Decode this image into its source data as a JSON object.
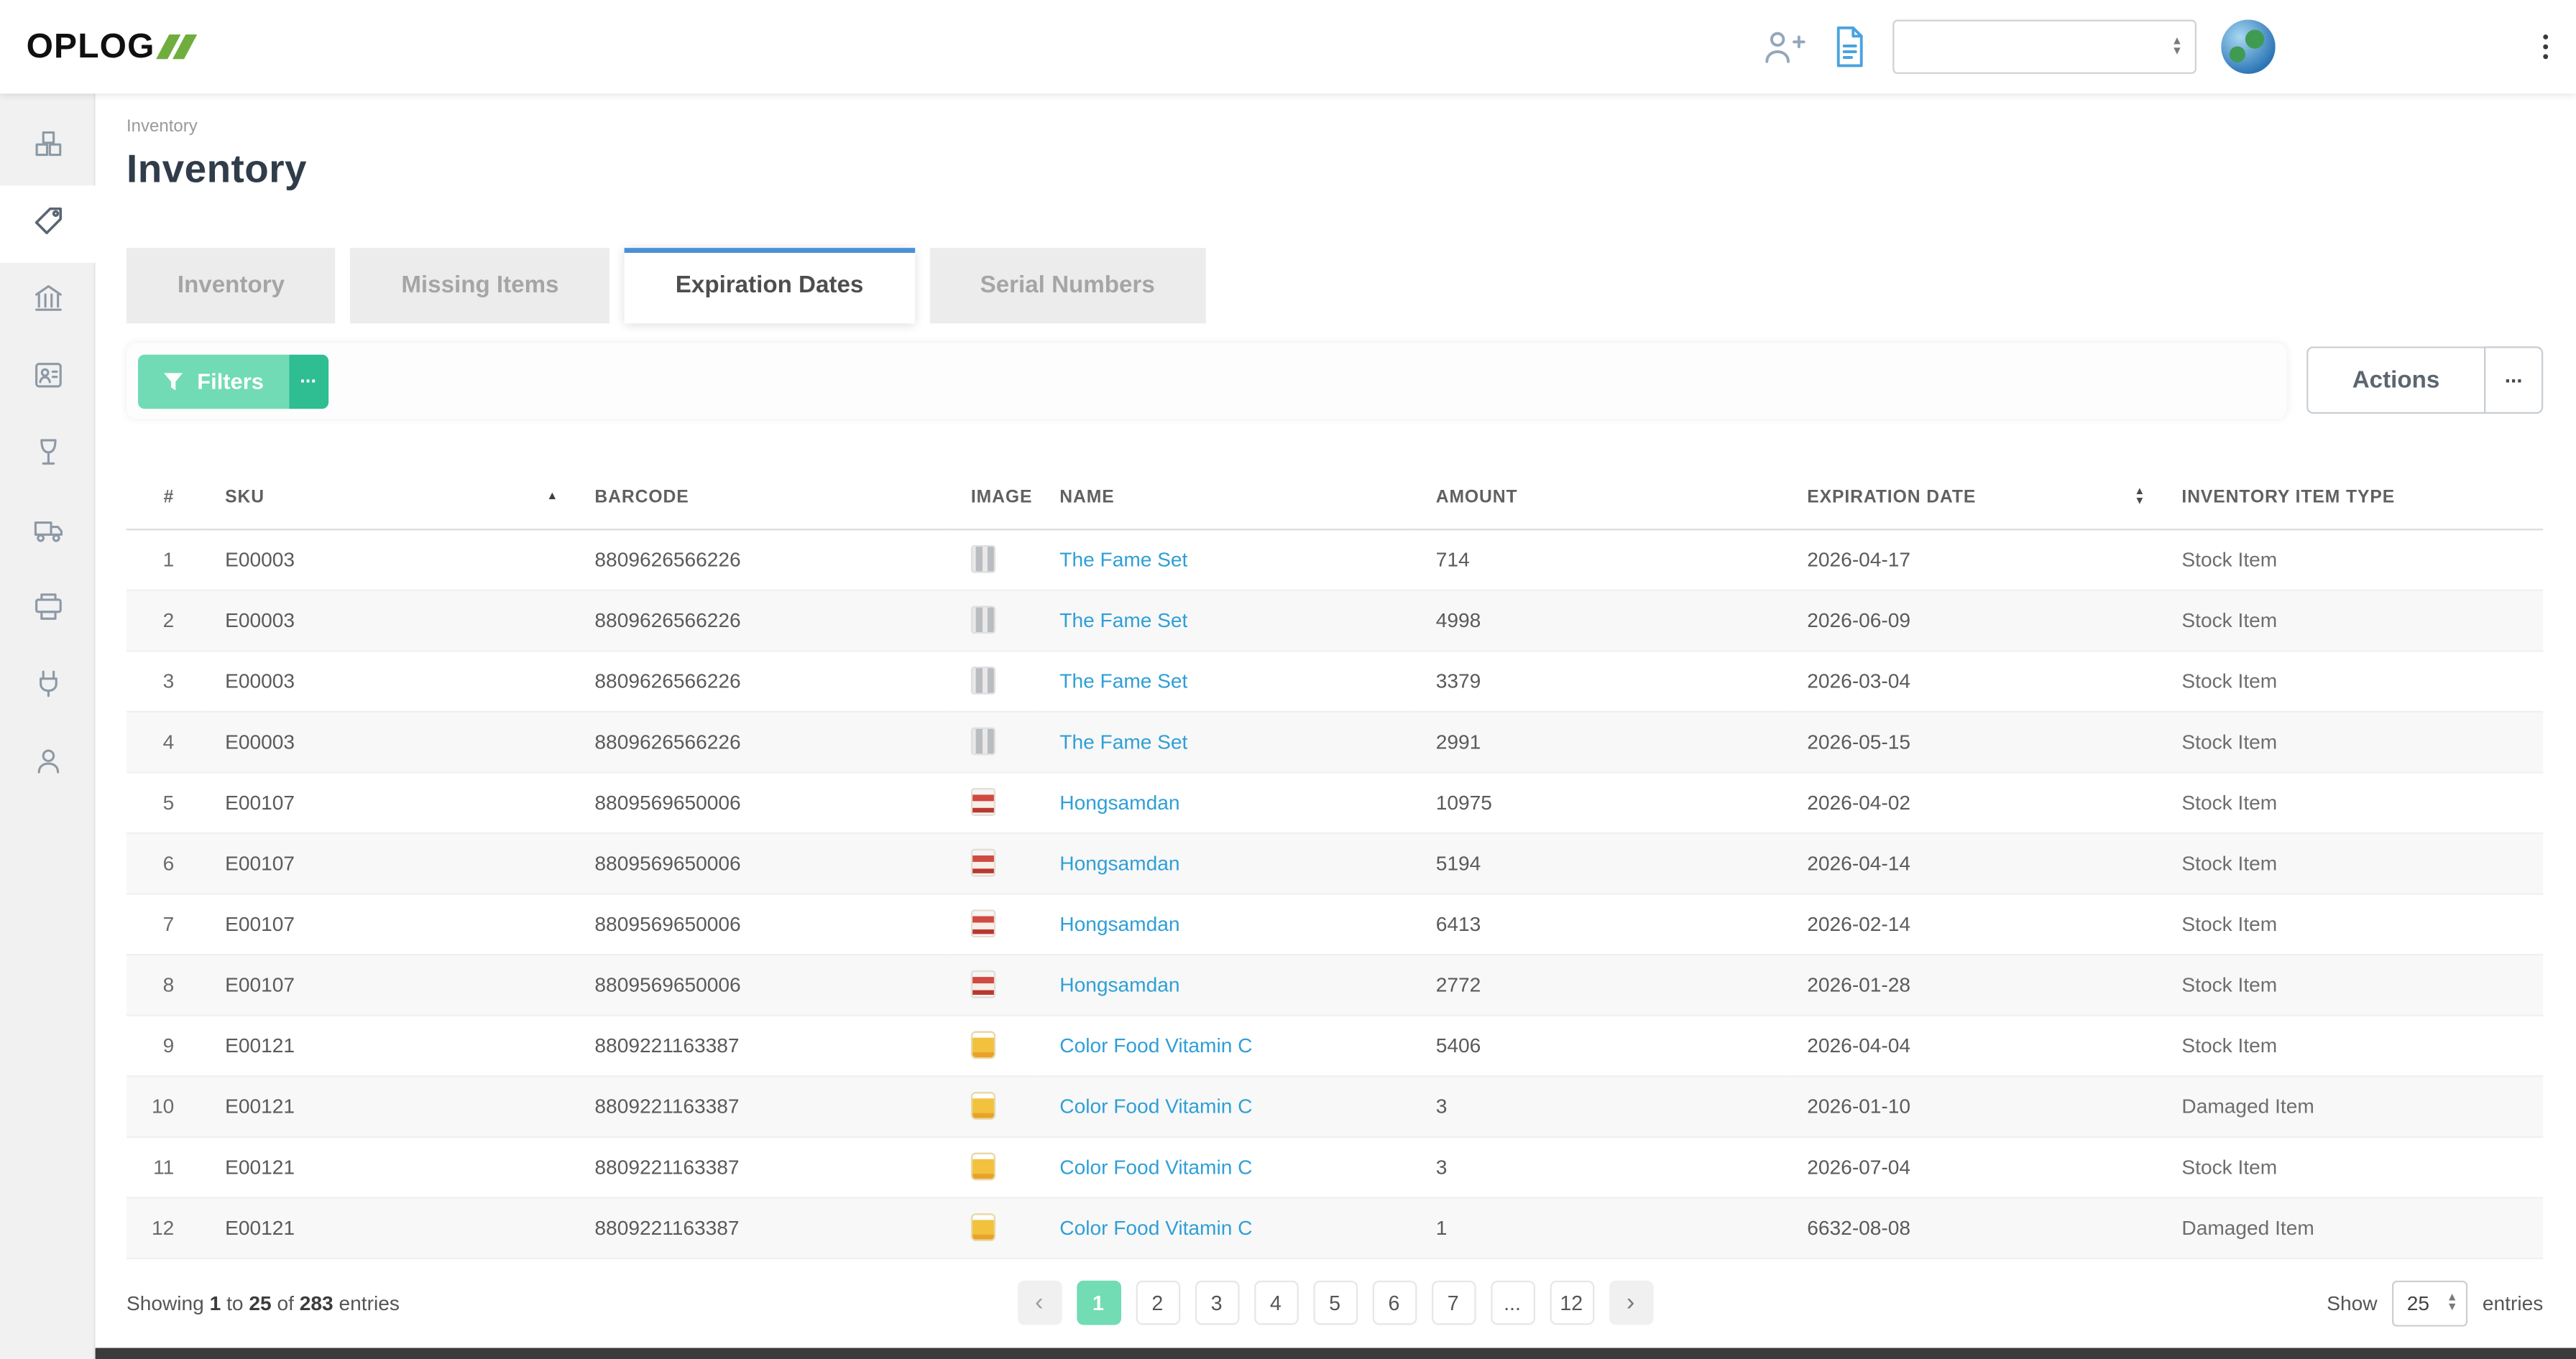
{
  "brand": {
    "name": "OPLOG"
  },
  "topbar": {
    "language_select": {
      "value": ""
    },
    "icons": {
      "add_user": "add-user-icon",
      "document": "document-icon",
      "avatar": "globe-avatar",
      "kebab_menu": "kebab-menu-icon"
    }
  },
  "sidebar": {
    "items": [
      {
        "icon": "packages-icon",
        "active": false
      },
      {
        "icon": "tag-icon",
        "active": true
      },
      {
        "icon": "warehouse-icon",
        "active": false
      },
      {
        "icon": "id-card-icon",
        "active": false
      },
      {
        "icon": "glass-icon",
        "active": false
      },
      {
        "icon": "truck-icon",
        "active": false
      },
      {
        "icon": "printer-icon",
        "active": false
      },
      {
        "icon": "plug-icon",
        "active": false
      },
      {
        "icon": "user-icon",
        "active": false
      }
    ]
  },
  "breadcrumb": "Inventory",
  "page": {
    "title": "Inventory"
  },
  "tabs": [
    {
      "label": "Inventory",
      "active": false
    },
    {
      "label": "Missing Items",
      "active": false
    },
    {
      "label": "Expiration Dates",
      "active": true
    },
    {
      "label": "Serial Numbers",
      "active": false
    }
  ],
  "toolbar": {
    "filters_label": "Filters",
    "filters_more": "...",
    "actions_label": "Actions",
    "actions_more": "..."
  },
  "table": {
    "columns": [
      "#",
      "SKU",
      "BARCODE",
      "IMAGE",
      "NAME",
      "AMOUNT",
      "EXPIRATION DATE",
      "INVENTORY ITEM TYPE"
    ],
    "sort": {
      "column": "SKU",
      "direction": "asc"
    },
    "rows": [
      {
        "index": "1",
        "sku": "E00003",
        "barcode": "8809626566226",
        "image": "bottles",
        "name": "The Fame Set",
        "amount": "714",
        "expiration": "2026-04-17",
        "type": "Stock Item"
      },
      {
        "index": "2",
        "sku": "E00003",
        "barcode": "8809626566226",
        "image": "bottles",
        "name": "The Fame Set",
        "amount": "4998",
        "expiration": "2026-06-09",
        "type": "Stock Item"
      },
      {
        "index": "3",
        "sku": "E00003",
        "barcode": "8809626566226",
        "image": "bottles",
        "name": "The Fame Set",
        "amount": "3379",
        "expiration": "2026-03-04",
        "type": "Stock Item"
      },
      {
        "index": "4",
        "sku": "E00003",
        "barcode": "8809626566226",
        "image": "bottles",
        "name": "The Fame Set",
        "amount": "2991",
        "expiration": "2026-05-15",
        "type": "Stock Item"
      },
      {
        "index": "5",
        "sku": "E00107",
        "barcode": "8809569650006",
        "image": "red-box",
        "name": "Hongsamdan",
        "amount": "10975",
        "expiration": "2026-04-02",
        "type": "Stock Item"
      },
      {
        "index": "6",
        "sku": "E00107",
        "barcode": "8809569650006",
        "image": "red-box",
        "name": "Hongsamdan",
        "amount": "5194",
        "expiration": "2026-04-14",
        "type": "Stock Item"
      },
      {
        "index": "7",
        "sku": "E00107",
        "barcode": "8809569650006",
        "image": "red-box",
        "name": "Hongsamdan",
        "amount": "6413",
        "expiration": "2026-02-14",
        "type": "Stock Item"
      },
      {
        "index": "8",
        "sku": "E00107",
        "barcode": "8809569650006",
        "image": "red-box",
        "name": "Hongsamdan",
        "amount": "2772",
        "expiration": "2026-01-28",
        "type": "Stock Item"
      },
      {
        "index": "9",
        "sku": "E00121",
        "barcode": "8809221163387",
        "image": "yellow-jar",
        "name": "Color Food Vitamin C",
        "amount": "5406",
        "expiration": "2026-04-04",
        "type": "Stock Item"
      },
      {
        "index": "10",
        "sku": "E00121",
        "barcode": "8809221163387",
        "image": "yellow-jar",
        "name": "Color Food Vitamin C",
        "amount": "3",
        "expiration": "2026-01-10",
        "type": "Damaged Item"
      },
      {
        "index": "11",
        "sku": "E00121",
        "barcode": "8809221163387",
        "image": "yellow-jar",
        "name": "Color Food Vitamin C",
        "amount": "3",
        "expiration": "2026-07-04",
        "type": "Stock Item"
      },
      {
        "index": "12",
        "sku": "E00121",
        "barcode": "8809221163387",
        "image": "yellow-jar",
        "name": "Color Food Vitamin C",
        "amount": "1",
        "expiration": "6632-08-08",
        "type": "Damaged Item"
      }
    ]
  },
  "footer": {
    "showing": {
      "lead": "Showing",
      "from": "1",
      "to_word": "to",
      "to": "25",
      "of_word": "of",
      "total": "283",
      "tail": "entries"
    },
    "pagination": {
      "prev": "‹",
      "next": "›",
      "pages": [
        {
          "label": "1",
          "active": true
        },
        {
          "label": "2",
          "active": false
        },
        {
          "label": "3",
          "active": false
        },
        {
          "label": "4",
          "active": false
        },
        {
          "label": "5",
          "active": false
        },
        {
          "label": "6",
          "active": false
        },
        {
          "label": "7",
          "active": false
        },
        {
          "label": "...",
          "active": false
        },
        {
          "label": "12",
          "active": false
        }
      ]
    },
    "page_size": {
      "show_label": "Show",
      "value": "25",
      "entries_label": "entries"
    }
  },
  "colors": {
    "accent_green": "#72dcb4",
    "accent_green_dark": "#2fbd92",
    "tab_active_border": "#4a90d9",
    "link_blue": "#2f9fd6",
    "brand_green": "#6fae3e"
  }
}
